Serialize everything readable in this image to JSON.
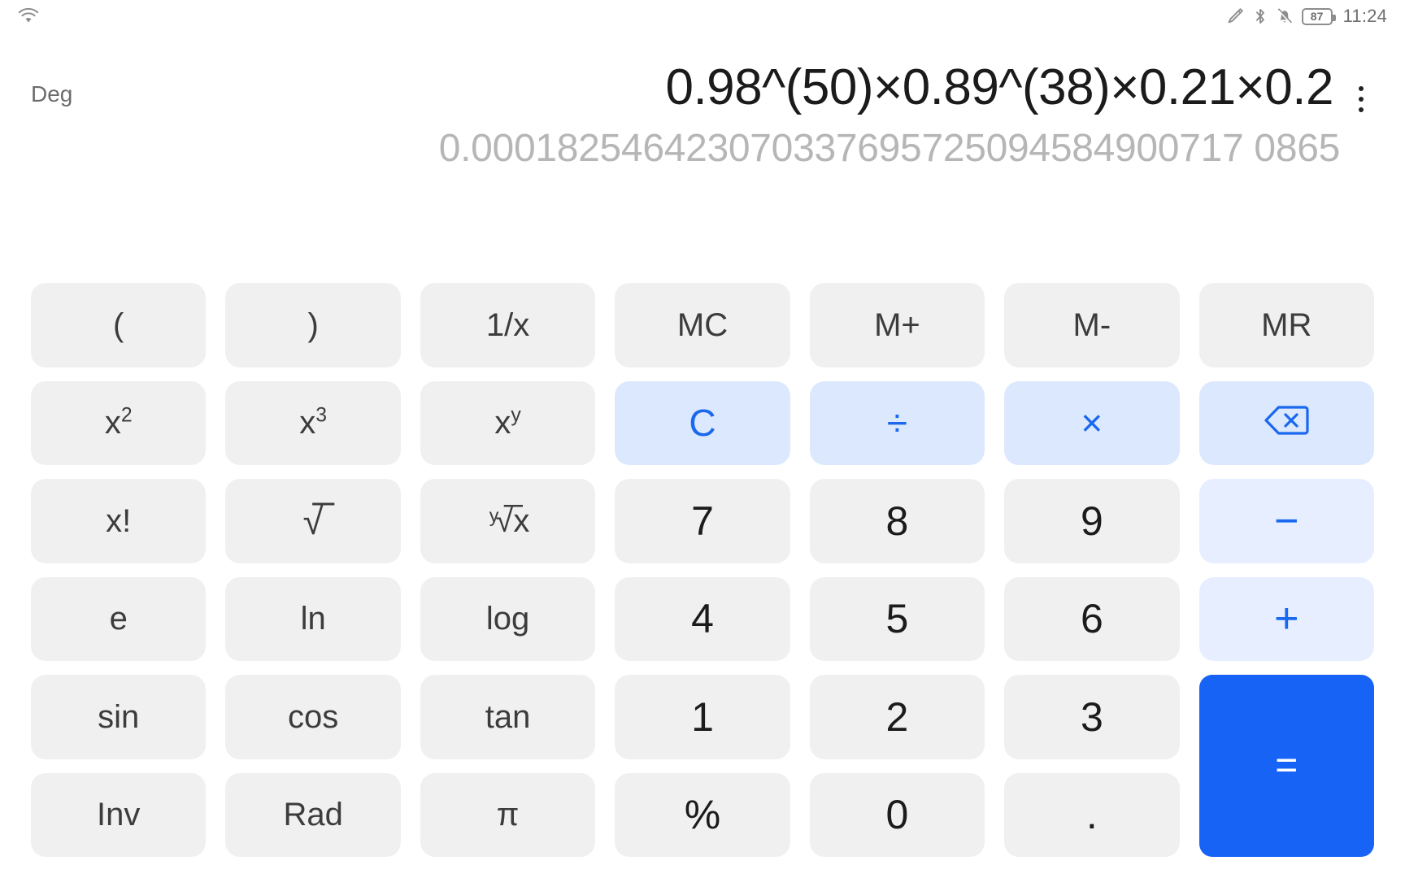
{
  "status_bar": {
    "wifi_icon": "wifi-icon",
    "stylus_icon": "stylus-icon",
    "bluetooth_icon": "bluetooth-icon",
    "mute_icon": "bell-muted-icon",
    "battery_level": "87",
    "time": "11:24"
  },
  "display": {
    "angle_mode": "Deg",
    "expression": "0.98^(50)×0.89^(38)×0.21×0.2",
    "result": "0.000182546423070337695725094584900717 0865",
    "overflow_menu_icon": "more-vertical-icon"
  },
  "keypad": {
    "rows": [
      [
        {
          "label": "(",
          "name": "open-paren",
          "style": "key"
        },
        {
          "label": ")",
          "name": "close-paren",
          "style": "key"
        },
        {
          "label": "1/x",
          "name": "reciprocal",
          "style": "key"
        },
        {
          "label": "MC",
          "name": "memory-clear",
          "style": "key"
        },
        {
          "label": "M+",
          "name": "memory-add",
          "style": "key"
        },
        {
          "label": "M-",
          "name": "memory-subtract",
          "style": "key"
        },
        {
          "label": "MR",
          "name": "memory-recall",
          "style": "key"
        }
      ],
      [
        {
          "label": "x²",
          "name": "square",
          "style": "key"
        },
        {
          "label": "x³",
          "name": "cube",
          "style": "key"
        },
        {
          "label": "xʸ",
          "name": "power",
          "style": "key"
        },
        {
          "label": "C",
          "name": "clear",
          "style": "func-blue"
        },
        {
          "label": "÷",
          "name": "divide",
          "style": "func-blue"
        },
        {
          "label": "×",
          "name": "multiply",
          "style": "func-blue"
        },
        {
          "label": "",
          "name": "backspace",
          "style": "func-blue",
          "icon": "backspace-icon"
        }
      ],
      [
        {
          "label": "x!",
          "name": "factorial",
          "style": "key"
        },
        {
          "label": "√",
          "name": "square-root",
          "style": "key"
        },
        {
          "label": "ʸ√x",
          "name": "nth-root",
          "style": "key"
        },
        {
          "label": "7",
          "name": "digit-7",
          "style": "num"
        },
        {
          "label": "8",
          "name": "digit-8",
          "style": "num"
        },
        {
          "label": "9",
          "name": "digit-9",
          "style": "num"
        },
        {
          "label": "−",
          "name": "subtract",
          "style": "op-lite"
        }
      ],
      [
        {
          "label": "e",
          "name": "euler-constant",
          "style": "key"
        },
        {
          "label": "ln",
          "name": "natural-log",
          "style": "key"
        },
        {
          "label": "log",
          "name": "log",
          "style": "key"
        },
        {
          "label": "4",
          "name": "digit-4",
          "style": "num"
        },
        {
          "label": "5",
          "name": "digit-5",
          "style": "num"
        },
        {
          "label": "6",
          "name": "digit-6",
          "style": "num"
        },
        {
          "label": "+",
          "name": "add",
          "style": "op-lite"
        }
      ],
      [
        {
          "label": "sin",
          "name": "sine",
          "style": "key"
        },
        {
          "label": "cos",
          "name": "cosine",
          "style": "key"
        },
        {
          "label": "tan",
          "name": "tangent",
          "style": "key"
        },
        {
          "label": "1",
          "name": "digit-1",
          "style": "num"
        },
        {
          "label": "2",
          "name": "digit-2",
          "style": "num"
        },
        {
          "label": "3",
          "name": "digit-3",
          "style": "num"
        },
        {
          "label": "=",
          "name": "equals",
          "style": "equals"
        }
      ],
      [
        {
          "label": "Inv",
          "name": "inverse",
          "style": "key"
        },
        {
          "label": "Rad",
          "name": "radian-mode",
          "style": "key"
        },
        {
          "label": "π",
          "name": "pi",
          "style": "key"
        },
        {
          "label": "%",
          "name": "percent",
          "style": "num"
        },
        {
          "label": "0",
          "name": "digit-0",
          "style": "num"
        },
        {
          "label": ".",
          "name": "decimal-point",
          "style": "num"
        }
      ]
    ]
  },
  "colors": {
    "accent": "#1763f5",
    "accent_light": "#dce8fd",
    "operator_bg": "#e6eeff",
    "key_bg": "#f0f0f0"
  }
}
